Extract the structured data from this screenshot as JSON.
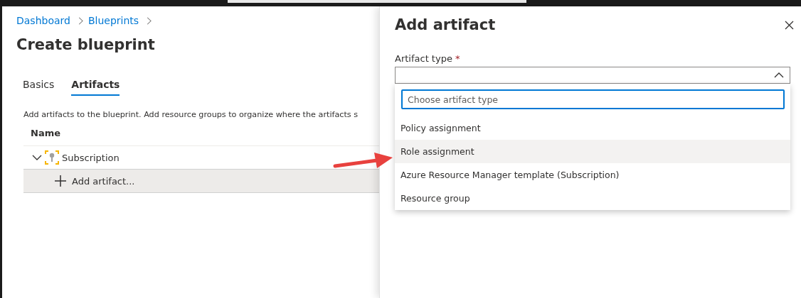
{
  "breadcrumb": [
    "Dashboard",
    "Blueprints"
  ],
  "page_title": "Create blueprint",
  "tabs": [
    {
      "label": "Basics",
      "selected": false
    },
    {
      "label": "Artifacts",
      "selected": true
    }
  ],
  "description": "Add artifacts to the blueprint. Add resource groups to organize where the artifacts s",
  "table": {
    "columns": [
      "Name"
    ],
    "rows": [
      {
        "kind": "scope",
        "label": "Subscription",
        "expanded": true
      },
      {
        "kind": "action",
        "label": "Add artifact..."
      }
    ]
  },
  "panel": {
    "title": "Add artifact",
    "field": {
      "label": "Artifact type",
      "required_mark": "*",
      "expanded": true,
      "search": {
        "placeholder": "Choose artifact type"
      },
      "options": [
        {
          "label": "Policy assignment",
          "selected": false
        },
        {
          "label": "Role assignment",
          "selected": true
        },
        {
          "label": "Azure Resource Manager template (Subscription)",
          "selected": false
        },
        {
          "label": "Resource group",
          "selected": false
        }
      ]
    }
  }
}
